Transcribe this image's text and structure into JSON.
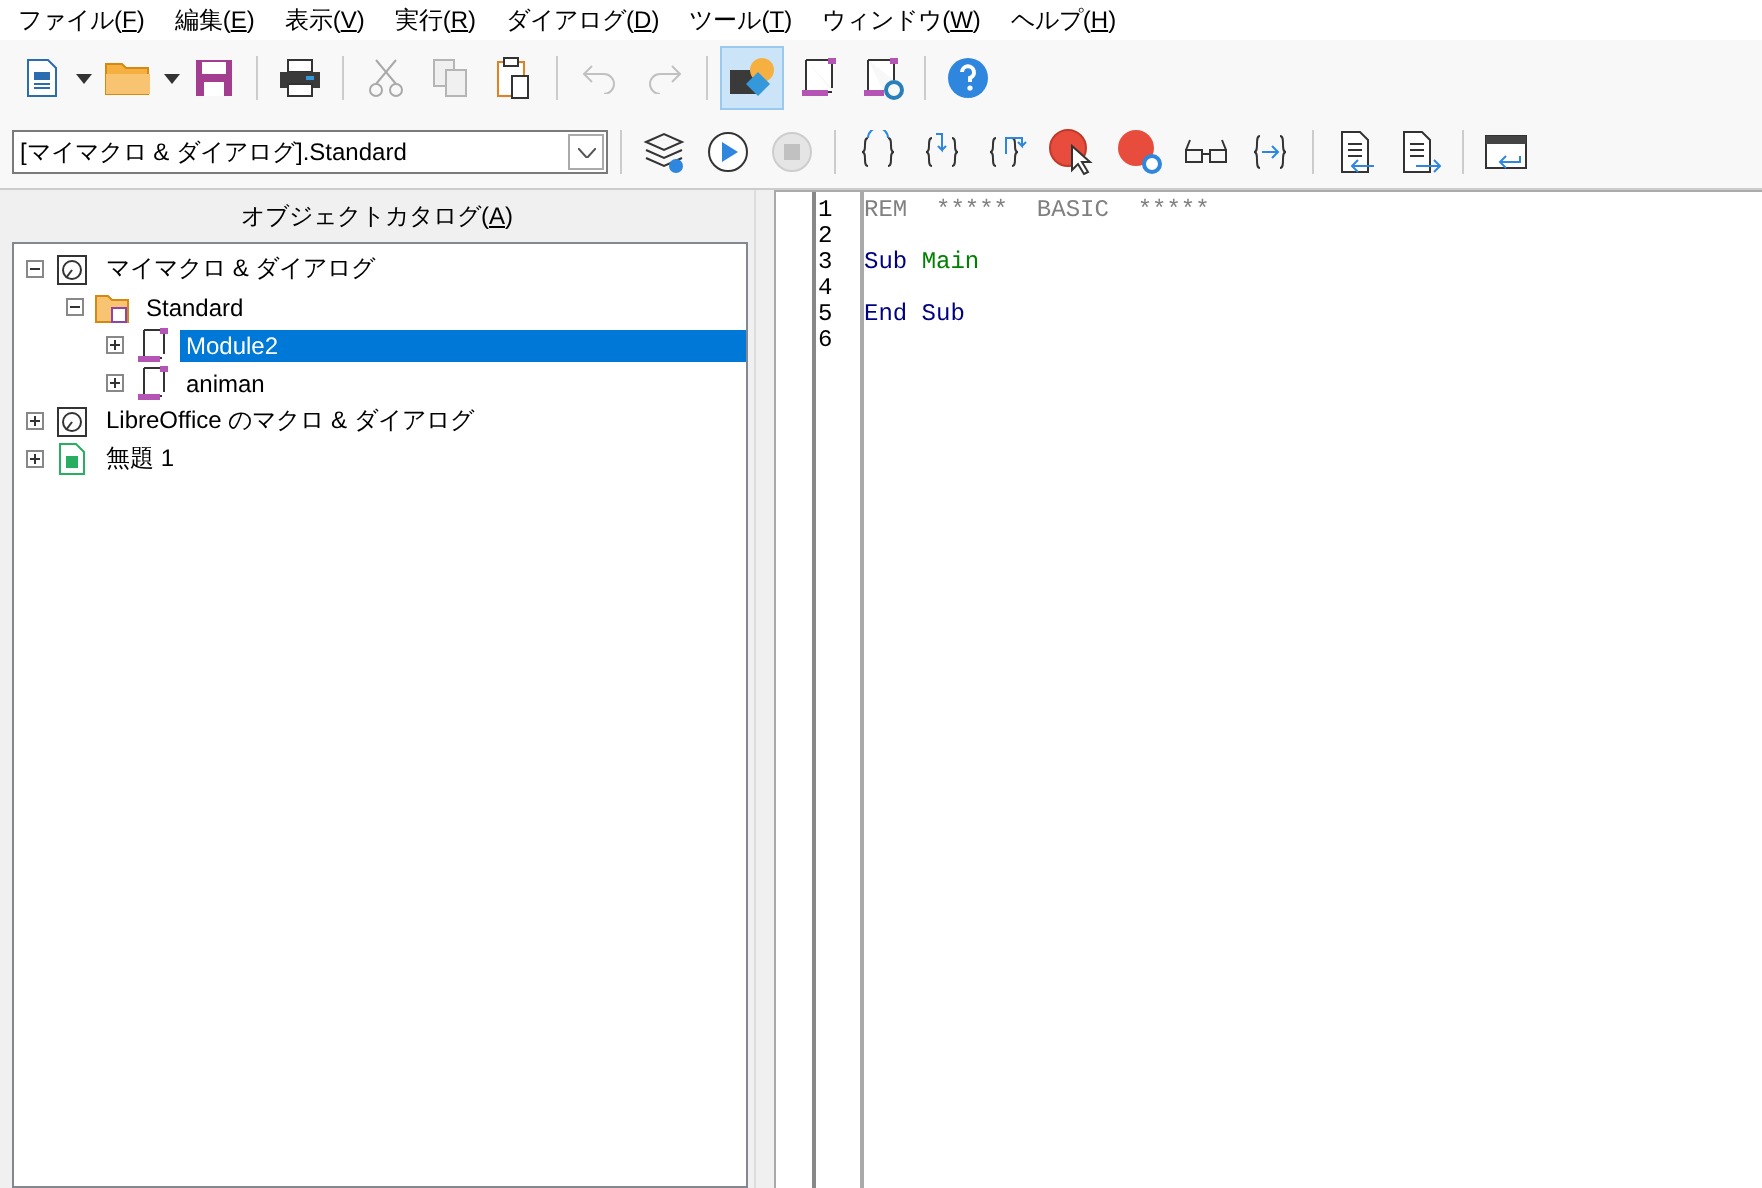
{
  "menu": [
    {
      "before": "ファイル(",
      "key": "F",
      "after": ")"
    },
    {
      "before": "編集(",
      "key": "E",
      "after": ")"
    },
    {
      "before": "表示(",
      "key": "V",
      "after": ")"
    },
    {
      "before": "実行(",
      "key": "R",
      "after": ")"
    },
    {
      "before": "ダイアログ(",
      "key": "D",
      "after": ")"
    },
    {
      "before": "ツール(",
      "key": "T",
      "after": ")"
    },
    {
      "before": "ウィンドウ(",
      "key": "W",
      "after": ")"
    },
    {
      "before": "ヘルプ(",
      "key": "H",
      "after": ")"
    }
  ],
  "toolbar": {
    "catalog_button_on": true
  },
  "library_select": {
    "value": "[マイマクロ & ダイアログ].Standard"
  },
  "catalog": {
    "title": {
      "before": "オブジェクトカタログ(",
      "key": "A",
      "after": ")"
    },
    "tree": [
      {
        "label": "マイマクロ & ダイアログ",
        "kind": "library",
        "expanded": true,
        "selected": false,
        "children": [
          {
            "label": "Standard",
            "kind": "folder",
            "expanded": true,
            "selected": false,
            "children": [
              {
                "label": "Module2",
                "kind": "module",
                "expanded": false,
                "selected": true
              },
              {
                "label": "animan",
                "kind": "module",
                "expanded": false,
                "selected": false
              }
            ]
          }
        ]
      },
      {
        "label": "LibreOffice のマクロ & ダイアログ",
        "kind": "library",
        "expanded": false,
        "selected": false
      },
      {
        "label": "無題 1",
        "kind": "document",
        "expanded": false,
        "selected": false
      }
    ]
  },
  "editor": {
    "lines": [
      {
        "number": "1",
        "tokens": [
          {
            "text": "REM  *****  BASIC  *****",
            "kind": "comment"
          }
        ]
      },
      {
        "number": "2"
      },
      {
        "number": "3",
        "tokens": [
          {
            "text": "Sub ",
            "kind": "keyword"
          },
          {
            "text": "Main",
            "kind": "ident"
          }
        ]
      },
      {
        "number": "4"
      },
      {
        "number": "5",
        "tokens": [
          {
            "text": "End Sub",
            "kind": "keyword"
          }
        ]
      },
      {
        "number": "6"
      }
    ]
  }
}
